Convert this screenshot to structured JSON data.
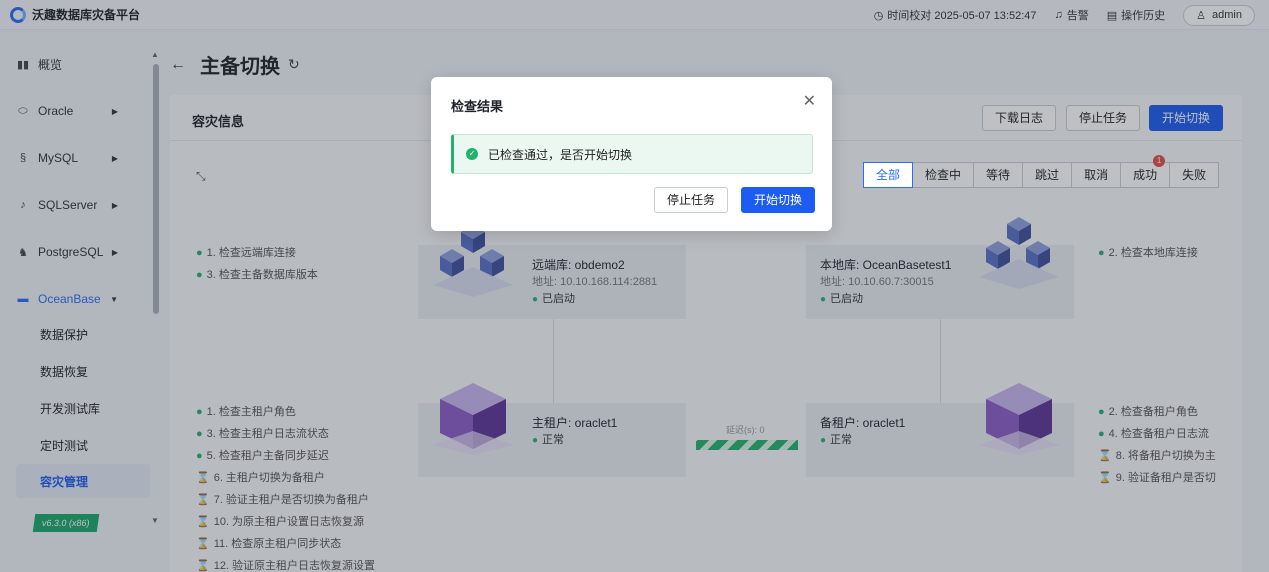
{
  "app": {
    "title": "沃趣数据库灾备平台"
  },
  "topbar": {
    "time_label": "时间校对 2025-05-07 13:52:47",
    "alarm_label": "告警",
    "history_label": "操作历史",
    "user": "admin"
  },
  "sidebar": {
    "items": [
      {
        "label": "概览"
      },
      {
        "label": "Oracle"
      },
      {
        "label": "MySQL"
      },
      {
        "label": "SQLServer"
      },
      {
        "label": "PostgreSQL"
      },
      {
        "label": "OceanBase"
      }
    ],
    "sub_items": [
      {
        "label": "数据保护"
      },
      {
        "label": "数据恢复"
      },
      {
        "label": "开发测试库"
      },
      {
        "label": "定时测试"
      },
      {
        "label": "容灾管理"
      }
    ],
    "version": "v6.3.0 (x86)"
  },
  "page": {
    "title": "主备切换"
  },
  "card": {
    "title": "容灾信息",
    "buttons": {
      "download_log": "下载日志",
      "stop_task": "停止任务",
      "start_switch": "开始切换"
    },
    "filters": [
      "全部",
      "检查中",
      "等待",
      "跳过",
      "取消",
      "成功",
      "失败"
    ],
    "success_badge": "1"
  },
  "checks": {
    "left_top": [
      "1. 检查远端库连接",
      "3. 检查主备数据库版本"
    ],
    "right_top": [
      "2. 检查本地库连接"
    ],
    "left_bottom_ok": [
      "1. 检查主租户角色",
      "3. 检查主租户日志流状态",
      "5. 检查租户主备同步延迟"
    ],
    "left_bottom_wait": [
      "6. 主租户切换为备租户",
      "7. 验证主租户是否切换为备租户",
      "10. 为原主租户设置日志恢复源",
      "11. 检查原主租户同步状态",
      "12. 验证原主租户日志恢复源设置"
    ],
    "right_bottom_ok": [
      "2. 检查备租户角色",
      "4. 检查备租户日志流"
    ],
    "right_bottom_wait": [
      "8. 将备租户切换为主",
      "9. 验证备租户是否切"
    ]
  },
  "nodes": {
    "remote": {
      "name": "远端库: obdemo2",
      "addr": "地址: 10.10.168.114:2881",
      "status": "已启动"
    },
    "local": {
      "name": "本地库: OceanBasetest1",
      "addr": "地址: 10.10.60.7:30015",
      "status": "已启动"
    },
    "primary": {
      "name": "主租户: oraclet1",
      "status": "正常"
    },
    "standby": {
      "name": "备租户: oraclet1",
      "status": "正常"
    },
    "delay_label": "延迟(s): 0"
  },
  "modal": {
    "title": "检查结果",
    "message": "已检查通过，是否开始切换",
    "stop_label": "停止任务",
    "start_label": "开始切换"
  },
  "colors": {
    "primary": "#1d5cf0",
    "success": "#23b26d",
    "cube_blue": "#4a5fb8",
    "cube_purple": "#6a3fa8"
  }
}
